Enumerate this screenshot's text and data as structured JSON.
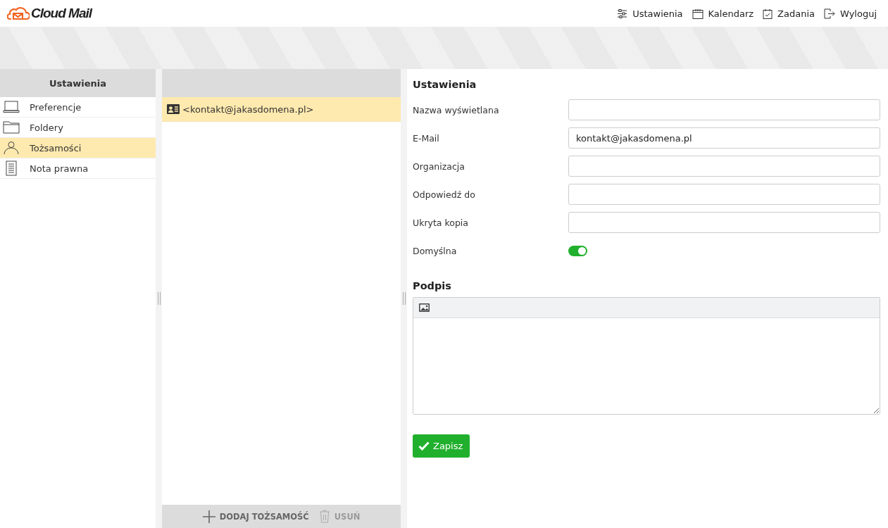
{
  "header": {
    "logo": "Cloud Mail",
    "nav": [
      {
        "label": "Ustawienia"
      },
      {
        "label": "Kalendarz"
      },
      {
        "label": "Zadania"
      },
      {
        "label": "Wyloguj"
      }
    ]
  },
  "sidebar": {
    "title": "Ustawienia",
    "items": [
      {
        "label": "Preferencje",
        "selected": false
      },
      {
        "label": "Foldery",
        "selected": false
      },
      {
        "label": "Tożsamości",
        "selected": true
      },
      {
        "label": "Nota prawna",
        "selected": false
      }
    ]
  },
  "identities": {
    "items": [
      {
        "label": "<kontakt@jakasdomena.pl>",
        "selected": true
      }
    ],
    "actions": [
      {
        "label": "DODAJ TOŻSAMOŚĆ",
        "disabled": false
      },
      {
        "label": "USUŃ",
        "disabled": true
      }
    ]
  },
  "form": {
    "title": "Ustawienia",
    "fields": [
      {
        "label": "Nazwa wyświetlana"
      },
      {
        "label": "E-Mail",
        "value": "kontakt@jakasdomena.pl"
      },
      {
        "label": "Organizacja"
      },
      {
        "label": "Odpowiedź do"
      },
      {
        "label": "Ukryta kopia"
      }
    ],
    "default": {
      "label": "Domyślna",
      "on": true
    },
    "signature_title": "Podpis",
    "save": "Zapisz"
  }
}
